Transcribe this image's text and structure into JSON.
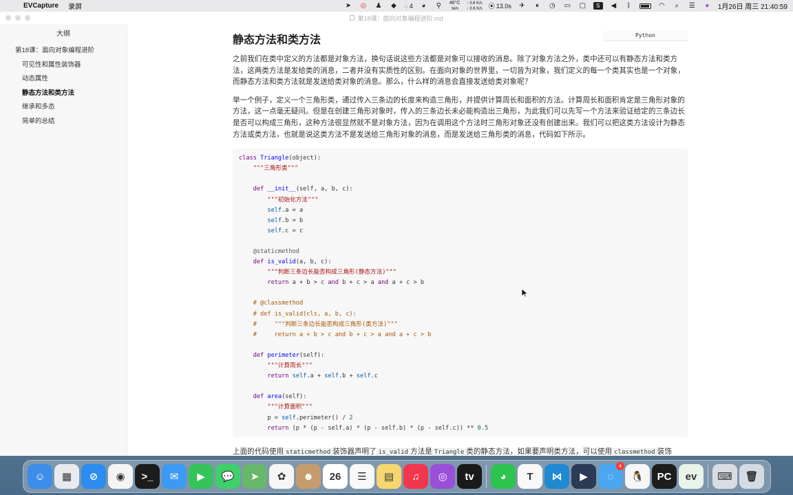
{
  "menubar": {
    "app_name": "EVCapture",
    "menu": "录屏",
    "notify_count": "4",
    "temp": "46°C",
    "temp_sub": "SEN",
    "net_up": "↑ 3.6 K/s",
    "net_down": "↓ 3.6 K/s",
    "record_time": "13.0s",
    "clock": "1月26日 周三  21:40:59"
  },
  "window": {
    "title": "第18课：面向对象编程进阶.md"
  },
  "sidebar": {
    "title": "大纲",
    "items": [
      {
        "label": "第18课：面向对象编程进阶",
        "level": 1
      },
      {
        "label": "可见性和属性装饰器",
        "level": 2
      },
      {
        "label": "动态属性",
        "level": 2
      },
      {
        "label": "静态方法和类方法",
        "level": 2,
        "active": true
      },
      {
        "label": "继承和多态",
        "level": 2
      },
      {
        "label": "简单的总结",
        "level": 2
      }
    ]
  },
  "content": {
    "heading": "静态方法和类方法",
    "lang_tag": "Python",
    "para1": "之前我们在类中定义的方法都是对象方法，换句话说这些方法都是对象可以接收的消息。除了对象方法之外，类中还可以有静态方法和类方法，这两类方法是发给类的消息，二者并没有实质性的区别。在面向对象的世界里，一切皆为对象，我们定义的每一个类其实也是一个对象，而静态方法和类方法就是发送给类对象的消息。那么，什么样的消息会直接发送给类对象呢？",
    "para2": "举一个例子，定义一个三角形类，通过传入三条边的长度来构造三角形，并提供计算周长和面积的方法。计算周长和面积肯定是三角形对象的方法，这一点毫无疑问。但是在创建三角形对象时，传入的三条边长未必能构造出三角形，为此我们可以先写一个方法来验证给定的三条边长是否可以构成三角形，这种方法很显然就不是对象方法，因为在调用这个方法时三角形对象还没有创建出来。我们可以把这类方法设计为静态方法或类方法，也就是说这类方法不是发送给三角形对象的消息，而是发送给三角形类的消息，代码如下所示。",
    "bottom": {
      "t1": "上面的代码使用",
      "c1": "staticmethod",
      "t2": "装饰器声明了",
      "c2": "is_valid",
      "t3": "方法是",
      "c3": "Triangle",
      "t4": "类的静态方法，如果要声明类方法，可以使用",
      "c4": "classmethod",
      "t5": "装饰"
    },
    "code": {
      "class_kw": "class",
      "class_name": "Triangle",
      "class_base": "(object):",
      "doc1": "\"\"\"三角形类\"\"\"",
      "init_def": "def",
      "init_name": "__init__",
      "init_args": "(self, a, b, c):",
      "doc2": "\"\"\"初始化方法\"\"\"",
      "self_a": "self",
      "assign_a": ".a = a",
      "self_b": "self",
      "assign_b": ".b = b",
      "self_c": "self",
      "assign_c": ".c = c",
      "deco": "@staticmethod",
      "valid_def": "def",
      "valid_name": "is_valid",
      "valid_args": "(a, b, c):",
      "doc3": "\"\"\"判断三条边长能否构成三角形(静态方法)\"\"\"",
      "ret1": "return",
      "ret1_expr_1": " a + b > c ",
      "and1": "and",
      "ret1_expr_2": " b + c > a ",
      "and2": "and",
      "ret1_expr_3": " a + c > b",
      "c1": "# @classmethod",
      "c2": "# def is_valid(cls, a, b, c):",
      "c3": "#     \"\"\"判断三条边长能否构成三角形(类方法)\"\"\"",
      "c4": "#     return a + b > c and b + c > a and a + c > b",
      "per_def": "def",
      "per_name": "perimeter",
      "per_args": "(self):",
      "doc4": "\"\"\"计算周长\"\"\"",
      "ret2": "return",
      "ret2_s1": "self",
      "ret2_p1": ".a + ",
      "ret2_s2": "self",
      "ret2_p2": ".b + ",
      "ret2_s3": "self",
      "ret2_p3": ".c",
      "area_def": "def",
      "area_name": "area",
      "area_args": "(self):",
      "doc5": "\"\"\"计算面积\"\"\"",
      "p_assign": "p = ",
      "p_self": "self",
      "p_call": ".perimeter() / ",
      "p_num": "2",
      "ret3": "return",
      "ret3_expr": " (p * (p - self.a) * (p - self.b) * (p - self.c)) ** ",
      "ret3_num": "0.5"
    }
  },
  "dock": {
    "items": [
      {
        "name": "finder-icon",
        "color": "#3d8ee8",
        "glyph": "☺"
      },
      {
        "name": "launchpad-icon",
        "color": "#e8eaf0",
        "glyph": "▦"
      },
      {
        "name": "safari-icon",
        "color": "#2c8cf0",
        "glyph": "⊘"
      },
      {
        "name": "chrome-icon",
        "color": "#f4f4f4",
        "glyph": "◉"
      },
      {
        "name": "terminal-icon",
        "color": "#1c1c1c",
        "glyph": ">_"
      },
      {
        "name": "mail-icon",
        "color": "#3c9af2",
        "glyph": "✉"
      },
      {
        "name": "facetime-icon",
        "color": "#35c45a",
        "glyph": "▶"
      },
      {
        "name": "messages-icon",
        "color": "#3fd06a",
        "glyph": "💬"
      },
      {
        "name": "maps-icon",
        "color": "#67b86a",
        "glyph": "➤"
      },
      {
        "name": "photos-icon",
        "color": "#f6f6f6",
        "glyph": "✿"
      },
      {
        "name": "contacts-icon",
        "color": "#c69c6d",
        "glyph": "☻"
      },
      {
        "name": "calendar-icon",
        "color": "#ffffff",
        "glyph": "26"
      },
      {
        "name": "reminders-icon",
        "color": "#f8f8f8",
        "glyph": "☰"
      },
      {
        "name": "notes-icon",
        "color": "#f5d770",
        "glyph": "▤"
      },
      {
        "name": "music-icon",
        "color": "#f2364e",
        "glyph": "♫"
      },
      {
        "name": "podcasts-icon",
        "color": "#9a4fd8",
        "glyph": "◎"
      },
      {
        "name": "tv-icon",
        "color": "#1a1a1a",
        "glyph": "tv"
      },
      {
        "name": "wechat-icon",
        "color": "#2dc34f",
        "glyph": "◕"
      },
      {
        "name": "typora-icon",
        "color": "#f8f8f8",
        "glyph": "T"
      },
      {
        "name": "vscode-icon",
        "color": "#1f8ad2",
        "glyph": "⋈"
      },
      {
        "name": "screenrecorder-icon",
        "color": "#2b3a55",
        "glyph": "▶"
      },
      {
        "name": "chat-icon",
        "color": "#4aa7f0",
        "glyph": "◌",
        "badge": "4"
      },
      {
        "name": "qq-icon",
        "color": "#f6f6f6",
        "glyph": "🐧"
      },
      {
        "name": "pycharm-icon",
        "color": "#1d1d1d",
        "glyph": "PC"
      },
      {
        "name": "evcapture-icon",
        "color": "#e8f3ea",
        "glyph": "ev"
      },
      {
        "name": "keyboard-icon",
        "color": "#d9dde2",
        "glyph": "⌨"
      },
      {
        "name": "trash-icon",
        "color": "#d4dbe3",
        "glyph": "🗑"
      }
    ]
  }
}
